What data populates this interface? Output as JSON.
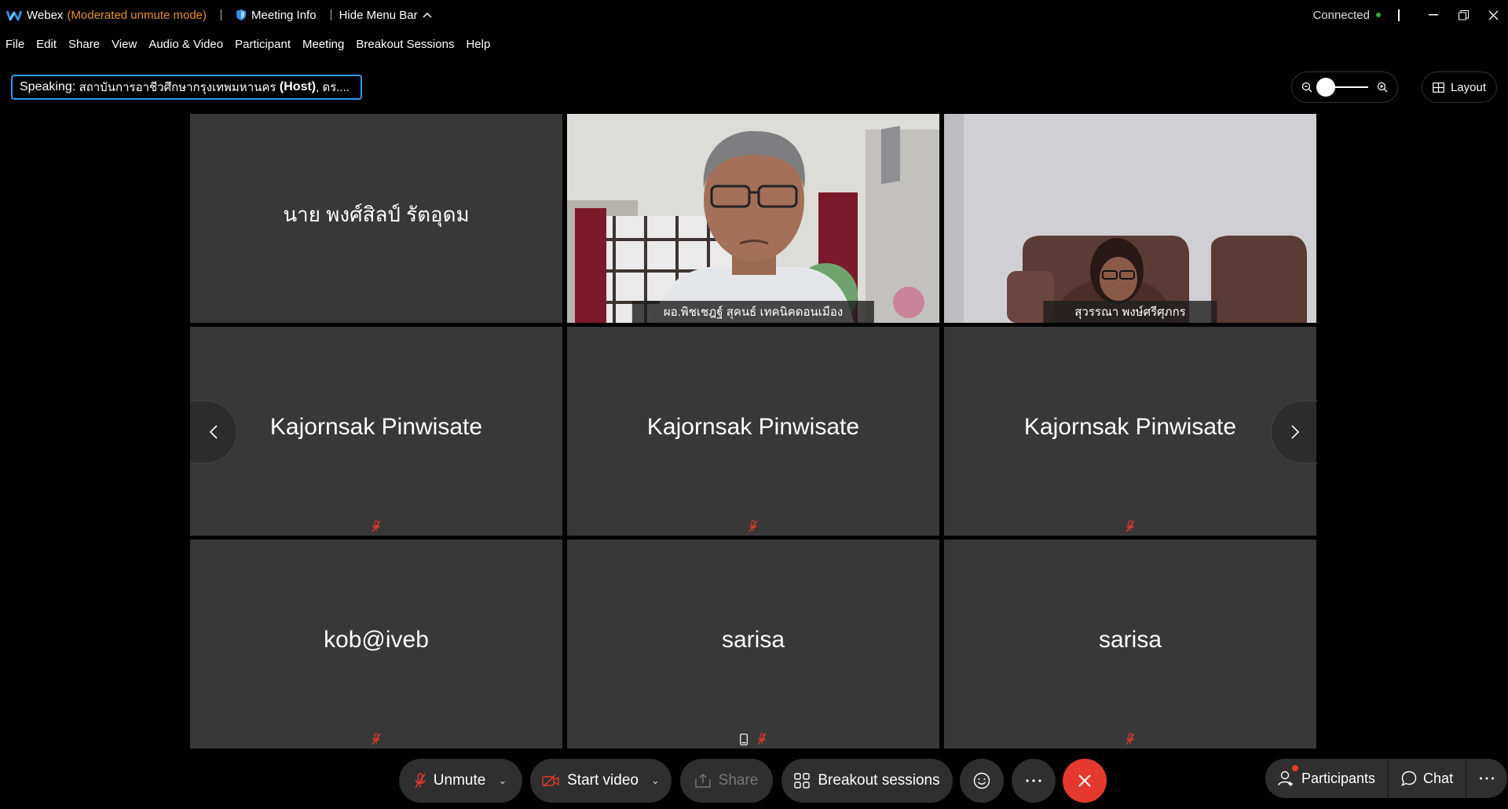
{
  "titlebar": {
    "app_name": "Webex",
    "mode": "(Moderated unmute mode)",
    "meeting_info": "Meeting Info",
    "hide_menu_bar": "Hide Menu Bar",
    "connection_status": "Connected"
  },
  "menu": [
    "File",
    "Edit",
    "Share",
    "View",
    "Audio & Video",
    "Participant",
    "Meeting",
    "Breakout Sessions",
    "Help"
  ],
  "speaking": {
    "prefix": "Speaking: ",
    "name": "สถาบันการอาชีวศึกษากรุงเทพมหานคร",
    "role": " (Host)",
    "suffix": ", ดร...."
  },
  "layout_button": "Layout",
  "tiles": [
    {
      "name": "นาย พงศ์สิลป์ รัตอุดม",
      "type": "name"
    },
    {
      "name": "ผอ.พิชเชฎฐ์ สุคนธ์ เทคนิคดอนเมือง",
      "type": "video"
    },
    {
      "name": "สุวรรณา พงษ์ศรีศุภกร",
      "type": "video"
    },
    {
      "name": "Kajornsak Pinwisate",
      "type": "name"
    },
    {
      "name": "Kajornsak Pinwisate",
      "type": "name"
    },
    {
      "name": "Kajornsak Pinwisate",
      "type": "name"
    },
    {
      "name": "kob@iveb",
      "type": "name"
    },
    {
      "name": "sarisa",
      "type": "name"
    },
    {
      "name": "sarisa",
      "type": "name"
    }
  ],
  "toolbar": {
    "unmute": "Unmute",
    "start_video": "Start video",
    "share": "Share",
    "breakout_sessions": "Breakout sessions",
    "participants": "Participants",
    "chat": "Chat"
  },
  "colors": {
    "accent_blue": "#2e9bf0",
    "mode_orange": "#e8912d",
    "end_red": "#e5392f",
    "connected_green": "#2bb24c",
    "tile_bg": "#383838"
  }
}
